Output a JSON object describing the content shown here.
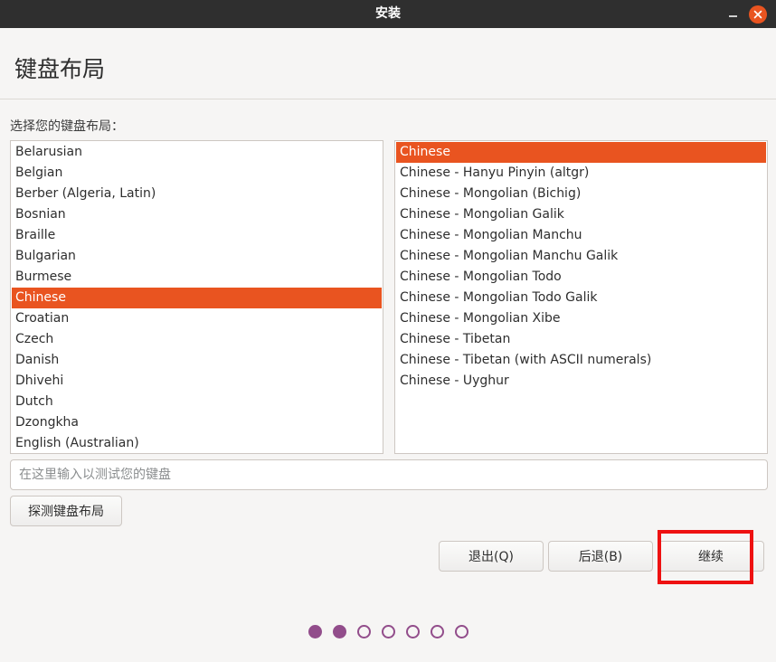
{
  "window": {
    "title": "安装"
  },
  "page": {
    "title": "键盘布局",
    "prompt": "选择您的键盘布局："
  },
  "layouts": [
    {
      "label": "Belarusian",
      "selected": false
    },
    {
      "label": "Belgian",
      "selected": false
    },
    {
      "label": "Berber (Algeria, Latin)",
      "selected": false
    },
    {
      "label": "Bosnian",
      "selected": false
    },
    {
      "label": "Braille",
      "selected": false
    },
    {
      "label": "Bulgarian",
      "selected": false
    },
    {
      "label": "Burmese",
      "selected": false
    },
    {
      "label": "Chinese",
      "selected": true
    },
    {
      "label": "Croatian",
      "selected": false
    },
    {
      "label": "Czech",
      "selected": false
    },
    {
      "label": "Danish",
      "selected": false
    },
    {
      "label": "Dhivehi",
      "selected": false
    },
    {
      "label": "Dutch",
      "selected": false
    },
    {
      "label": "Dzongkha",
      "selected": false
    },
    {
      "label": "English (Australian)",
      "selected": false
    }
  ],
  "variants": [
    {
      "label": "Chinese",
      "selected": true
    },
    {
      "label": "Chinese - Hanyu Pinyin (altgr)",
      "selected": false
    },
    {
      "label": "Chinese - Mongolian (Bichig)",
      "selected": false
    },
    {
      "label": "Chinese - Mongolian Galik",
      "selected": false
    },
    {
      "label": "Chinese - Mongolian Manchu",
      "selected": false
    },
    {
      "label": "Chinese - Mongolian Manchu Galik",
      "selected": false
    },
    {
      "label": "Chinese - Mongolian Todo",
      "selected": false
    },
    {
      "label": "Chinese - Mongolian Todo Galik",
      "selected": false
    },
    {
      "label": "Chinese - Mongolian Xibe",
      "selected": false
    },
    {
      "label": "Chinese - Tibetan",
      "selected": false
    },
    {
      "label": "Chinese - Tibetan (with ASCII numerals)",
      "selected": false
    },
    {
      "label": "Chinese - Uyghur",
      "selected": false
    }
  ],
  "test_field": {
    "value": "",
    "placeholder": "在这里输入以测试您的键盘"
  },
  "buttons": {
    "detect": "探测键盘布局",
    "quit": "退出(Q)",
    "back": "后退(B)",
    "continue": "继续"
  },
  "progress": {
    "total_steps": 7,
    "completed_steps": 2
  },
  "colors": {
    "accent": "#e95420",
    "titlebar": "#2f2f2f",
    "progress_dot": "#924d8b",
    "highlight": "#ee1111"
  }
}
